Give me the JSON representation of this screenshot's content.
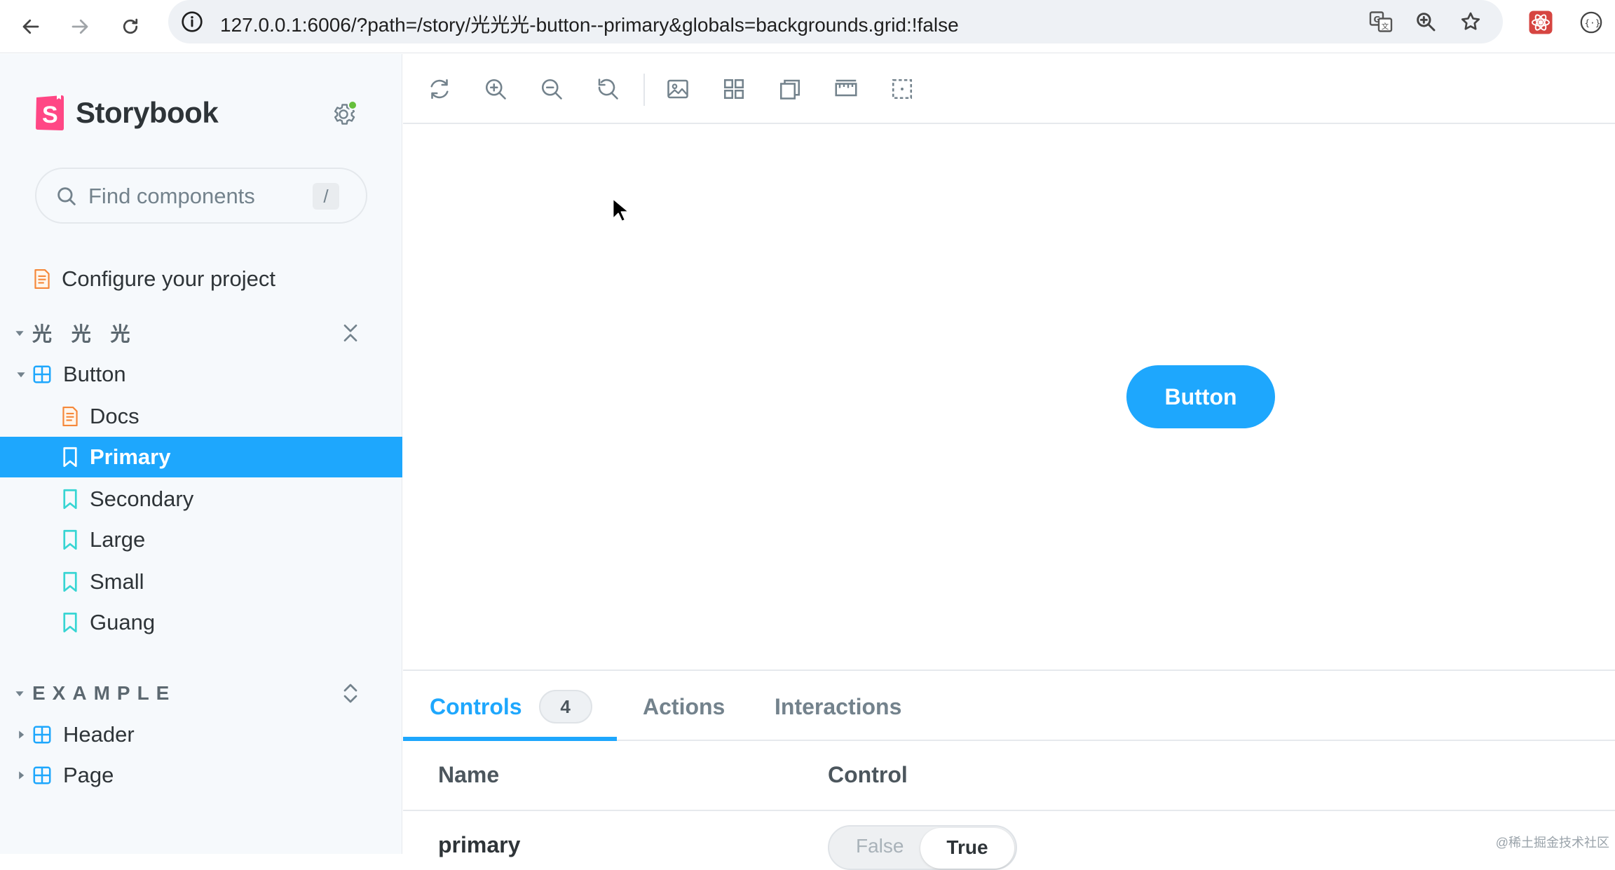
{
  "browser": {
    "url": "127.0.0.1:6006/?path=/story/光光光-button--primary&globals=backgrounds.grid:!false"
  },
  "sidebar": {
    "brand": "Storybook",
    "search": {
      "placeholder": "Find components",
      "shortcut": "/"
    },
    "configure_label": "Configure your project",
    "groups": [
      {
        "label": "光 光 光",
        "components": [
          {
            "label": "Button",
            "stories": [
              {
                "label": "Docs",
                "kind": "doc"
              },
              {
                "label": "Primary",
                "kind": "story",
                "selected": true
              },
              {
                "label": "Secondary",
                "kind": "story"
              },
              {
                "label": "Large",
                "kind": "story"
              },
              {
                "label": "Small",
                "kind": "story"
              },
              {
                "label": "Guang",
                "kind": "story"
              }
            ]
          }
        ]
      },
      {
        "label": "EXAMPLE",
        "components": [
          {
            "label": "Header"
          },
          {
            "label": "Page"
          }
        ]
      }
    ]
  },
  "toolbar": {
    "tools": [
      "reload-icon",
      "zoom-in-icon",
      "zoom-out-icon",
      "reset-zoom-icon",
      "background-icon",
      "grid-icon",
      "viewport-icon",
      "measure-icon",
      "outline-icon"
    ]
  },
  "preview": {
    "button_label": "Button"
  },
  "addons": {
    "tabs": [
      {
        "label": "Controls",
        "count": "4",
        "active": true
      },
      {
        "label": "Actions"
      },
      {
        "label": "Interactions"
      }
    ],
    "table": {
      "headers": {
        "name": "Name",
        "control": "Control"
      },
      "rows": [
        {
          "name": "primary",
          "toggle_off": "False",
          "toggle_on": "True"
        }
      ]
    }
  },
  "watermark": "@稀土掘金技术社区",
  "colors": {
    "accent": "#1ea7fd",
    "brand_pink": "#ff4785",
    "status_green": "#66bf3c"
  }
}
